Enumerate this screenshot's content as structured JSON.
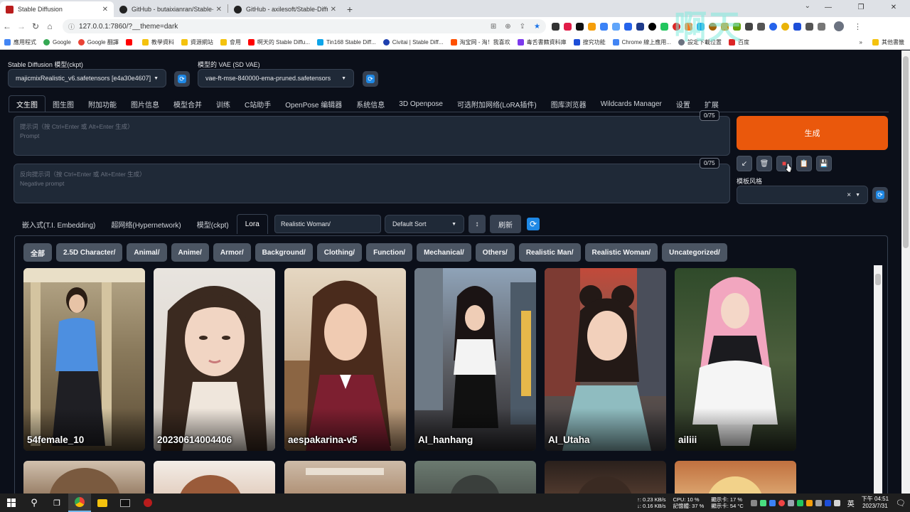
{
  "browser": {
    "tabs": [
      {
        "title": "Stable Diffusion",
        "active": true,
        "icon": "sd-icon"
      },
      {
        "title": "GitHub - butaixianran/Stable-D",
        "active": false,
        "icon": "github-icon"
      },
      {
        "title": "GitHub - axilesoft/Stable-Diffu",
        "active": false,
        "icon": "github-icon"
      }
    ],
    "new_tab": "+",
    "url": "127.0.0.1:7860/?__theme=dark",
    "bookmarks": [
      "應用程式",
      "Google",
      "Google 翻譯",
      "",
      "教學資料",
      "資源網站",
      "會用",
      "啊天的 Stable Diffu...",
      "Tin168 Stable Diff...",
      "Civitai | Stable Diff...",
      "淘宝网 - 淘！我喜欢",
      "毒舌書籍資料庫",
      "搜究功能",
      "Chrome 線上應用...",
      "設定下載位置",
      "百度"
    ],
    "bookmarks_more": "其他書籤",
    "watermark": "啊天"
  },
  "app": {
    "ckpt_label": "Stable Diffusion 模型(ckpt)",
    "ckpt_value": "majicmixRealistic_v6.safetensors [e4a30e4607]",
    "vae_label": "模型的 VAE (SD VAE)",
    "vae_value": "vae-ft-mse-840000-ema-pruned.safetensors",
    "tabs": [
      "文生图",
      "图生图",
      "附加功能",
      "图片信息",
      "模型合并",
      "训练",
      "C站助手",
      "OpenPose 编辑器",
      "系统信息",
      "3D Openpose",
      "可选附加网络(LoRA插件)",
      "图库浏览器",
      "Wildcards Manager",
      "设置",
      "扩展"
    ],
    "prompt_placeholder": "提示词（按 Ctrl+Enter 或 Alt+Enter 生成）",
    "prompt_sub": "Prompt",
    "neg_placeholder": "反向提示词（按 Ctrl+Enter 或 Alt+Enter 生成）",
    "neg_sub": "Negative prompt",
    "prompt_count": "0/75",
    "neg_count": "0/75",
    "generate": "生成",
    "style_label": "模板风格",
    "style_clear": "×",
    "subtabs": [
      "嵌入式(T.I. Embedding)",
      "超网络(Hypernetwork)",
      "模型(ckpt)",
      "Lora"
    ],
    "search_value": "Realistic Woman/",
    "sort_value": "Default Sort",
    "sort_dir": "↕",
    "refresh": "刷新",
    "filters": [
      "全部",
      "2.5D Character/",
      "Animal/",
      "Anime/",
      "Armor/",
      "Background/",
      "Clothing/",
      "Function/",
      "Mechanical/",
      "Others/",
      "Realistic Man/",
      "Realistic Woman/",
      "Uncategorized/"
    ],
    "cards": [
      "54female_10",
      "20230614004406",
      "aespakarina-v5",
      "AI_hanhang",
      "AI_Utaha",
      "ailiii"
    ]
  },
  "taskbar": {
    "net_up": "↑: 0.23 KB/s",
    "net_down": "↓: 0.16 KB/s",
    "cpu": "CPU: 10 %",
    "mem": "記憶體: 37 %",
    "gpu": "顯示卡: 17 %",
    "gpu_temp": "顯示卡: 54 °C",
    "ime": "英",
    "time": "下午 04:51",
    "date": "2023/7/31"
  }
}
